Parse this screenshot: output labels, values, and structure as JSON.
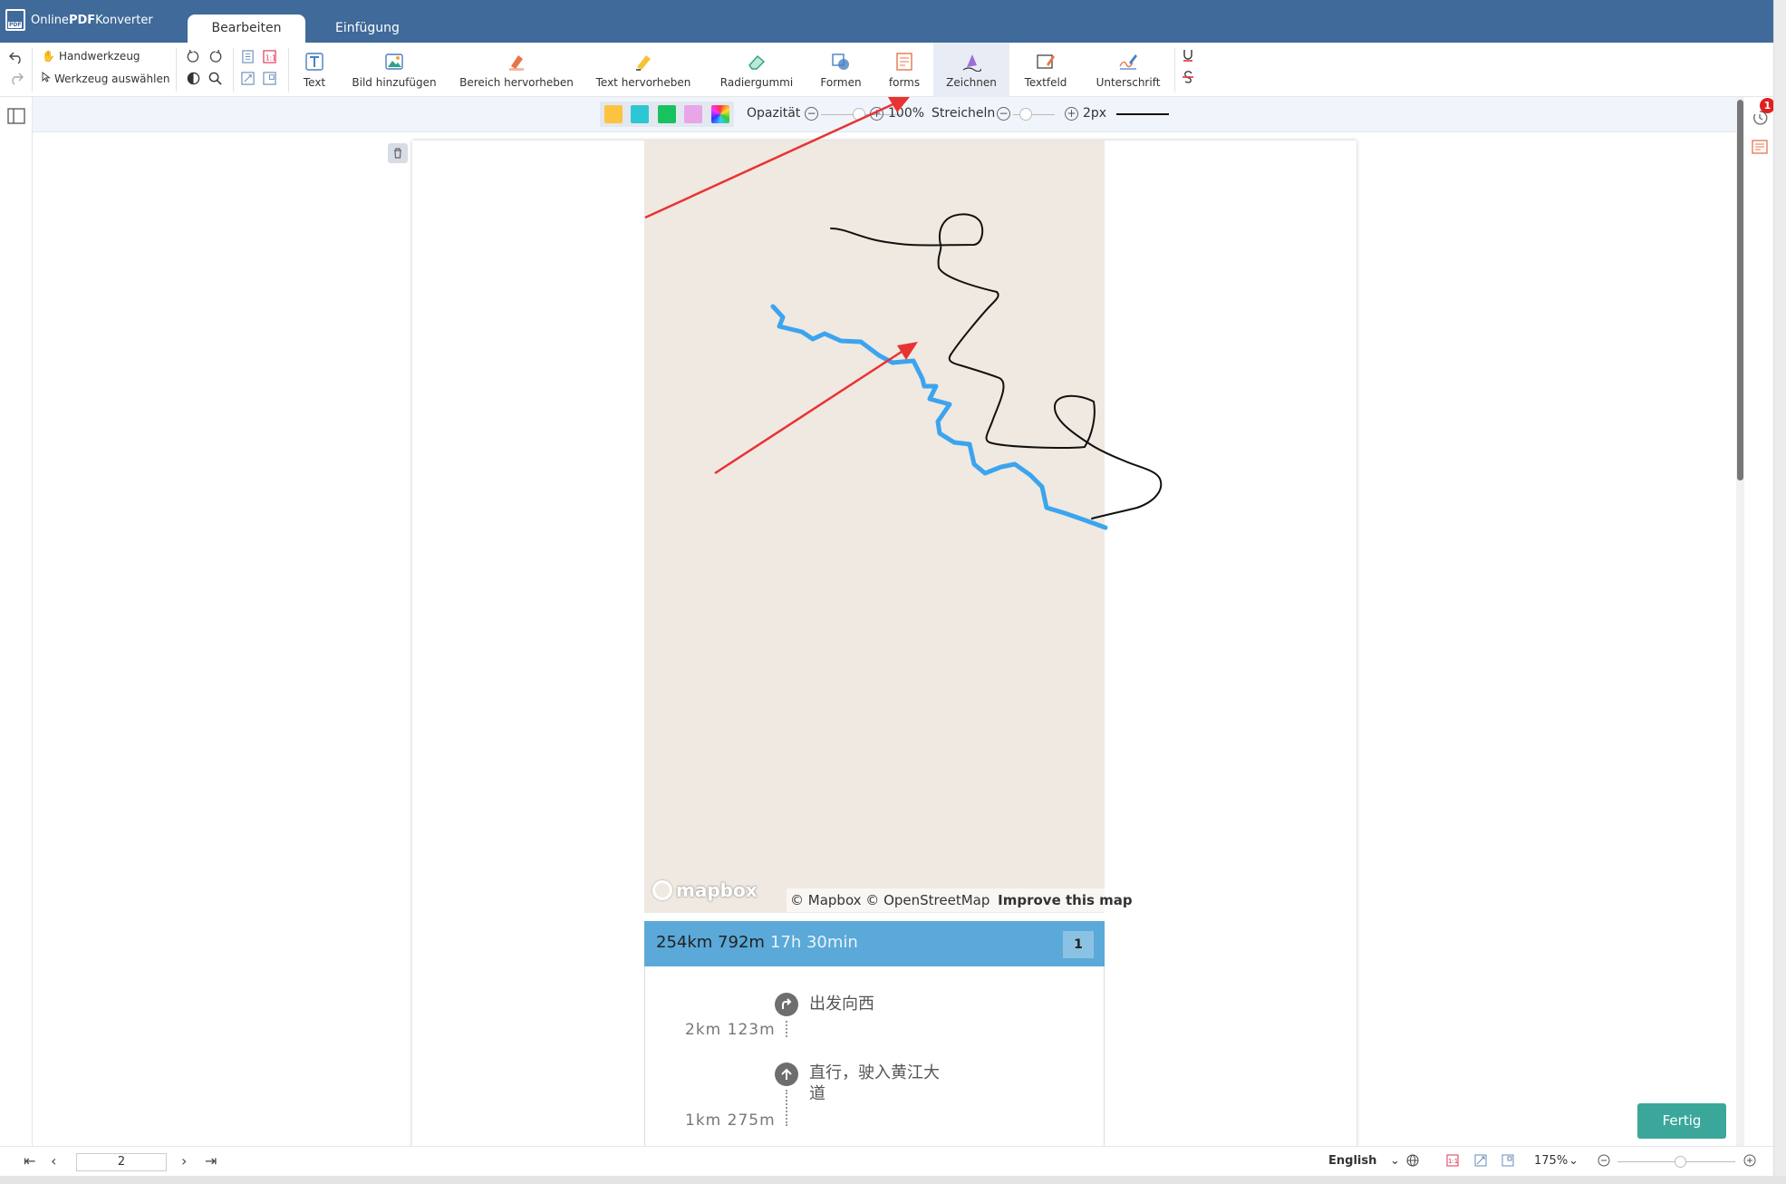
{
  "app": {
    "name_prefix": "Online",
    "name_bold": "PDF",
    "name_suffix": "Konverter"
  },
  "tabs": [
    {
      "label": "Bearbeiten",
      "active": true
    },
    {
      "label": "Einfügung",
      "active": false
    }
  ],
  "toolbar": {
    "hand_tool": "Handwerkzeug",
    "select_tool": "Werkzeug auswählen",
    "tools": [
      {
        "label": "Text",
        "icon": "text-icon"
      },
      {
        "label": "Bild hinzufügen",
        "icon": "image-icon"
      },
      {
        "label": "Bereich hervorheben",
        "icon": "area-highlight-icon"
      },
      {
        "label": "Text hervorheben",
        "icon": "text-highlight-icon"
      },
      {
        "label": "Radiergummi",
        "icon": "eraser-icon"
      },
      {
        "label": "Formen",
        "icon": "shapes-icon"
      },
      {
        "label": "forms",
        "icon": "forms-icon"
      },
      {
        "label": "Zeichnen",
        "icon": "draw-icon",
        "active": true
      },
      {
        "label": "Textfeld",
        "icon": "textfield-icon"
      },
      {
        "label": "Unterschrift",
        "icon": "signature-icon"
      }
    ]
  },
  "drawbar": {
    "colors": [
      "#fbc33f",
      "#2dc7d3",
      "#18c25e",
      "#e8a6e8"
    ],
    "opacity_label": "Opazität",
    "opacity_value": "100%",
    "stroke_label": "Streicheln",
    "stroke_value": "2px"
  },
  "document": {
    "map_logo": "mapbox",
    "attribution_1": "© Mapbox © OpenStreetMap",
    "attribution_2": "Improve this map",
    "route_distance": "254km 792m",
    "route_time": "17h 30min",
    "route_number": "1",
    "steps": [
      {
        "text": "出发向西",
        "distance": "2km 123m",
        "icon": "turn-right-icon"
      },
      {
        "text": "直行，驶入黄江大道",
        "text_line1": "直行，驶入黄江大",
        "text_line2": "道",
        "distance": "1km 275m",
        "icon": "straight-arrow-icon"
      }
    ]
  },
  "notification_count": "1",
  "done_button": "Fertig",
  "statusbar": {
    "page": "2",
    "language": "English",
    "zoom": "175%"
  }
}
